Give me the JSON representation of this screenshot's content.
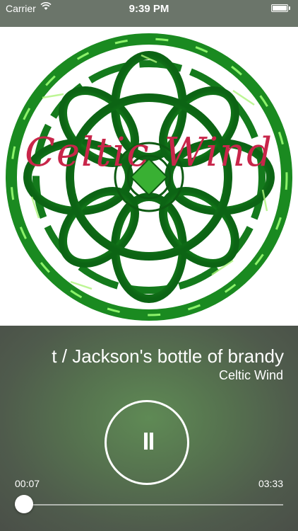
{
  "status_bar": {
    "carrier": "Carrier",
    "wifi_icon": "wifi-icon",
    "time": "9:39 PM",
    "battery_icon": "battery-icon"
  },
  "artwork": {
    "text": "Celtic Wind",
    "colors": {
      "text": "#c8264a",
      "knot": "#2fb52a"
    }
  },
  "now_playing": {
    "title": "t / Jackson's bottle of brandy",
    "artist": "Celtic Wind"
  },
  "player": {
    "state_icon": "pause-icon",
    "elapsed": "00:07",
    "duration": "03:33",
    "progress": 0.033
  }
}
